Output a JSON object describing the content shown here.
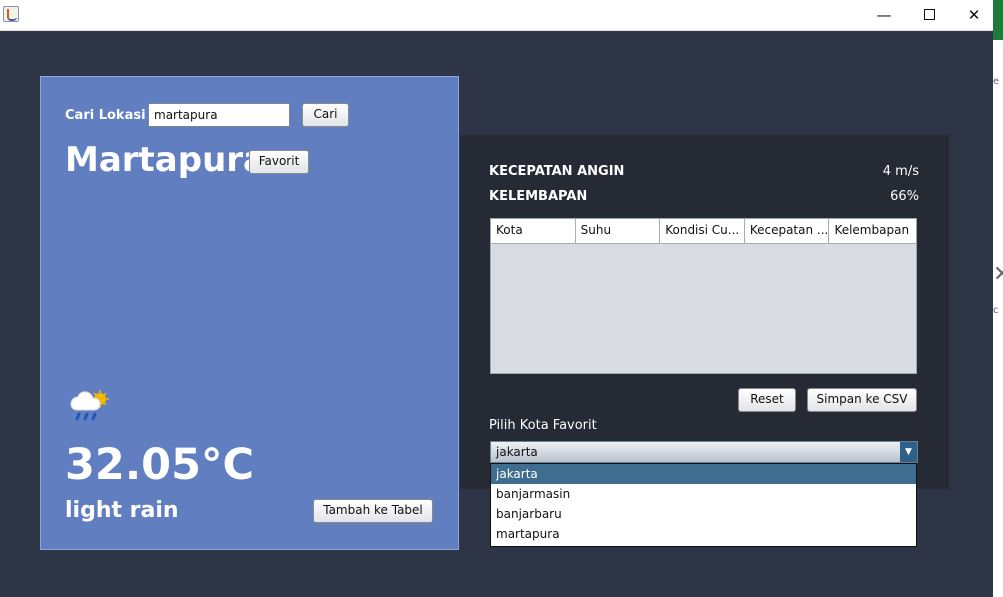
{
  "window": {
    "controls": {
      "minimize": "—",
      "close": "✕"
    }
  },
  "left_panel": {
    "search_label": "Cari Lokasi",
    "search_value": "martapura",
    "search_button": "Cari",
    "city_name": "Martapura",
    "favorite_button": "Favorit",
    "weather_icon": "rain-cloud-sun-icon",
    "temperature": "32.05°C",
    "condition": "light rain",
    "add_button": "Tambah ke Tabel"
  },
  "right_panel": {
    "wind_label": "KECEPATAN ANGIN",
    "wind_value": "4 m/s",
    "humidity_label": "KELEMBAPAN",
    "humidity_value": "66%",
    "table_headers": [
      "Kota",
      "Suhu",
      "Kondisi Cu...",
      "Kecepatan ...",
      "Kelembapan"
    ],
    "reset_button": "Reset",
    "csv_button": "Simpan ke CSV",
    "combo_label": "Pilih Kota Favorit",
    "combo_value": "jakarta",
    "dropdown_options": [
      "jakarta",
      "banjarmasin",
      "banjarbaru",
      "martapura"
    ],
    "selected_option": "jakarta"
  },
  "colors": {
    "window_background": "#2e3546",
    "left_panel": "#617fc0",
    "right_panel": "#252a35",
    "selection": "#3f6d8f"
  }
}
